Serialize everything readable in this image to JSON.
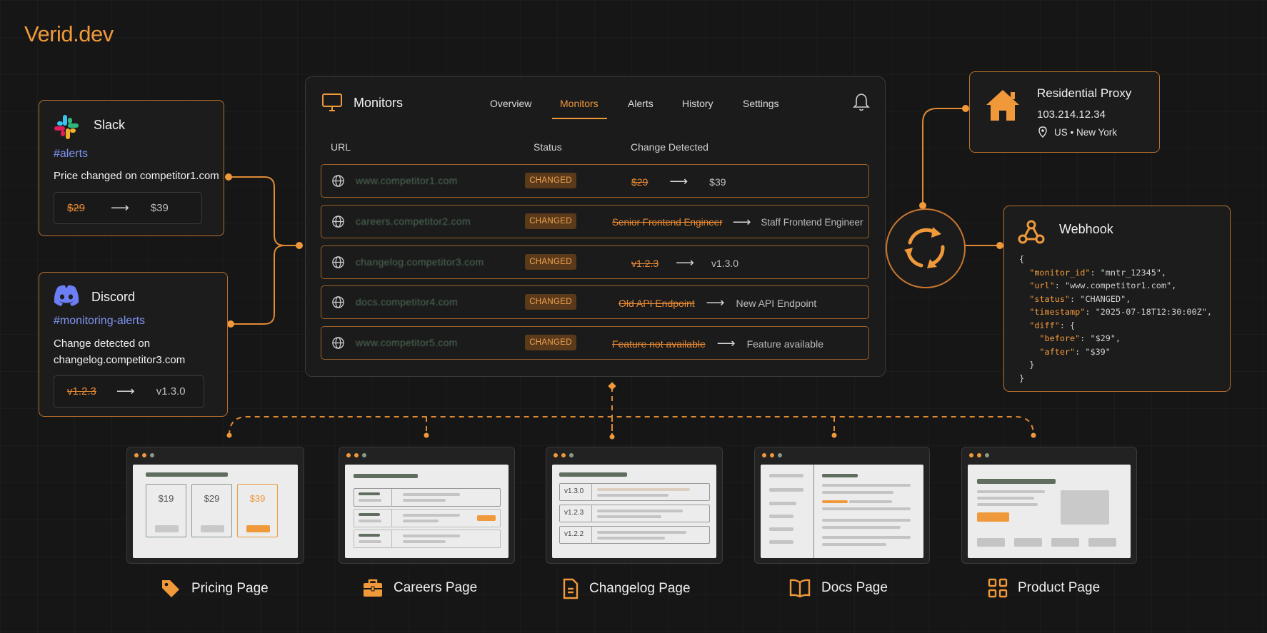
{
  "brand": {
    "name_main": "Verid",
    "name_ext": ".dev"
  },
  "slack": {
    "title": "Slack",
    "channel": "#alerts",
    "message": "Price changed on competitor1.com",
    "before": "$29",
    "after": "$39"
  },
  "discord": {
    "title": "Discord",
    "channel": "#monitoring-alerts",
    "message_line1": "Change detected on",
    "message_line2": "changelog.competitor3.com",
    "before": "v1.2.3",
    "after": "v1.3.0"
  },
  "monitors": {
    "title": "Monitors",
    "tabs": [
      "Overview",
      "Monitors",
      "Alerts",
      "History",
      "Settings"
    ],
    "active_tab": "Monitors",
    "columns": {
      "url": "URL",
      "status": "Status",
      "change": "Change Detected"
    },
    "arrow": "⟶",
    "rows": [
      {
        "url": "www.competitor1.com",
        "status": "CHANGED",
        "before": "$29",
        "after": "$39"
      },
      {
        "url": "careers.competitor2.com",
        "status": "CHANGED",
        "before": "Senior Frontend Engineer",
        "after": "Staff Frontend Engineer"
      },
      {
        "url": "changelog.competitor3.com",
        "status": "CHANGED",
        "before": "v1.2.3",
        "after": "v1.3.0"
      },
      {
        "url": "docs.competitor4.com",
        "status": "CHANGED",
        "before": "Old API Endpoint",
        "after": "New API Endpoint"
      },
      {
        "url": "www.competitor5.com",
        "status": "CHANGED",
        "before": "Feature not available",
        "after": "Feature available"
      }
    ]
  },
  "proxy": {
    "title": "Residential Proxy",
    "ip": "103.214.12.34",
    "location": "US • New York"
  },
  "webhook": {
    "title": "Webhook",
    "payload": {
      "monitor_id": "mntr_12345",
      "url": "www.competitor1.com",
      "status": "CHANGED",
      "timestamp": "2025-07-18T12:30:00Z",
      "diff_before": "$29",
      "diff_after": "$39"
    }
  },
  "pages": [
    {
      "label": "Pricing Page",
      "icon": "tag-icon",
      "prices": [
        "$19",
        "$29",
        "$39"
      ]
    },
    {
      "label": "Careers Page",
      "icon": "briefcase-icon"
    },
    {
      "label": "Changelog Page",
      "icon": "document-icon",
      "versions": [
        "v1.3.0",
        "v1.2.3",
        "v1.2.2"
      ]
    },
    {
      "label": "Docs Page",
      "icon": "book-icon"
    },
    {
      "label": "Product Page",
      "icon": "grid-icon"
    }
  ],
  "colors": {
    "accent": "#f0993a",
    "background": "#161616",
    "channel": "#7f93f0"
  }
}
